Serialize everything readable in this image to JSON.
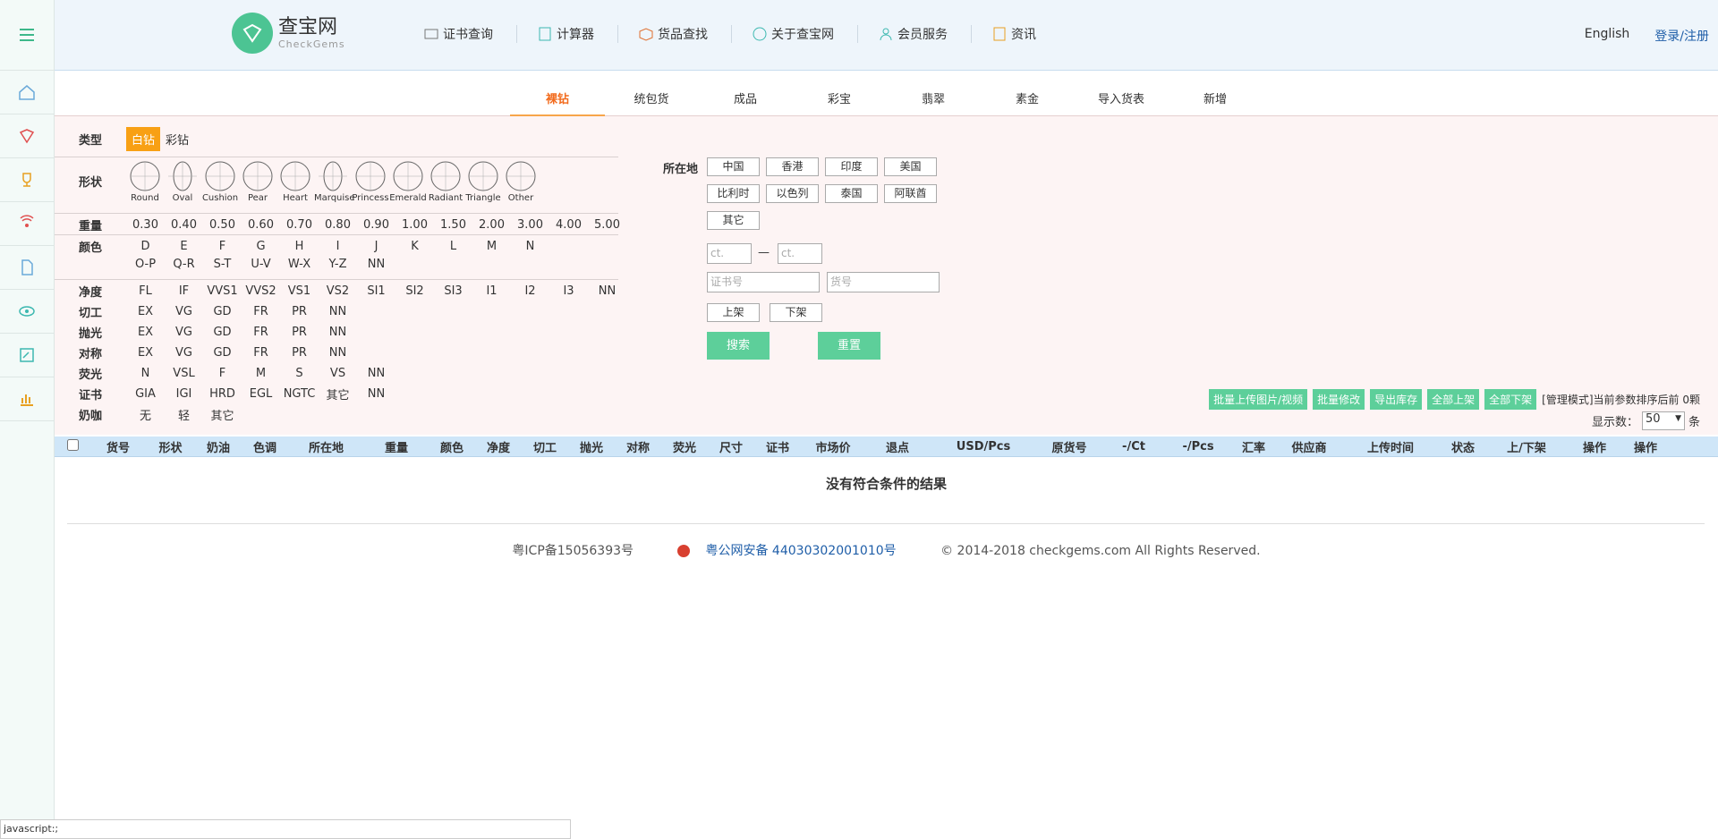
{
  "header": {
    "logo_cn": "查宝网",
    "logo_en": "CheckGems",
    "nav": [
      "证书查询",
      "计算器",
      "货品查找",
      "关于查宝网",
      "会员服务",
      "资讯"
    ],
    "lang": "English",
    "login": "登录/注册"
  },
  "tabs": [
    "裸钻",
    "统包货",
    "成品",
    "彩宝",
    "翡翠",
    "素金",
    "导入货表",
    "新增"
  ],
  "filters": {
    "type_label": "类型",
    "types": [
      "白钻",
      "彩钻"
    ],
    "shape_label": "形状",
    "shapes": [
      "Round",
      "Oval",
      "Cushion",
      "Pear",
      "Heart",
      "Marquise",
      "Princess",
      "Emerald",
      "Radiant",
      "Triangle",
      "Other"
    ],
    "weight_label": "重量",
    "weights": [
      "0.30",
      "0.40",
      "0.50",
      "0.60",
      "0.70",
      "0.80",
      "0.90",
      "1.00",
      "1.50",
      "2.00",
      "3.00",
      "4.00",
      "5.00"
    ],
    "color_label": "颜色",
    "colors1": [
      "D",
      "E",
      "F",
      "G",
      "H",
      "I",
      "J",
      "K",
      "L",
      "M",
      "N"
    ],
    "colors2": [
      "O-P",
      "Q-R",
      "S-T",
      "U-V",
      "W-X",
      "Y-Z",
      "NN"
    ],
    "clarity_label": "净度",
    "clarity": [
      "FL",
      "IF",
      "VVS1",
      "VVS2",
      "VS1",
      "VS2",
      "SI1",
      "SI2",
      "SI3",
      "I1",
      "I2",
      "I3",
      "NN"
    ],
    "cut_label": "切工",
    "cut": [
      "EX",
      "VG",
      "GD",
      "FR",
      "PR",
      "NN"
    ],
    "polish_label": "抛光",
    "polish": [
      "EX",
      "VG",
      "GD",
      "FR",
      "PR",
      "NN"
    ],
    "sym_label": "对称",
    "sym": [
      "EX",
      "VG",
      "GD",
      "FR",
      "PR",
      "NN"
    ],
    "fluor_label": "荧光",
    "fluor": [
      "N",
      "VSL",
      "F",
      "M",
      "S",
      "VS",
      "NN"
    ],
    "cert_label": "证书",
    "cert": [
      "GIA",
      "IGI",
      "HRD",
      "EGL",
      "NGTC",
      "其它",
      "NN"
    ],
    "milky_label": "奶咖",
    "milky": [
      "无",
      "轻",
      "其它"
    ]
  },
  "location": {
    "label": "所在地",
    "options": [
      "中国",
      "香港",
      "印度",
      "美国",
      "比利时",
      "以色列",
      "泰国",
      "阿联酋",
      "其它"
    ]
  },
  "inputs": {
    "ct_from": "ct.",
    "dash": "—",
    "ct_to": "ct.",
    "cert_no": "证书号",
    "stock_no": "货号"
  },
  "buttons": {
    "on_shelf": "上架",
    "off_shelf": "下架",
    "search": "搜索",
    "reset": "重置"
  },
  "actions": [
    "批量上传图片/视频",
    "批量修改",
    "导出库存",
    "全部上架",
    "全部下架"
  ],
  "mode_text": "[管理模式]当前参数排序后前 0颗",
  "perpage": {
    "label": "显示数：",
    "value": "50",
    "unit": "条"
  },
  "table": {
    "columns": [
      "货号",
      "形状",
      "奶油",
      "色调",
      "所在地",
      "重量",
      "颜色",
      "净度",
      "切工",
      "抛光",
      "对称",
      "荧光",
      "尺寸",
      "证书",
      "市场价",
      "退点",
      "USD/Pcs",
      "原货号",
      "-/Ct",
      "-/Pcs",
      "汇率",
      "供应商",
      "上传时间",
      "状态",
      "上/下架",
      "操作",
      "操作"
    ],
    "empty": "没有符合条件的结果"
  },
  "footer": {
    "icp": "粤ICP备15056393号",
    "police": "粤公网安备 44030302001010号",
    "copy": "© 2014-2018 checkgems.com All Rights Reserved."
  },
  "status": "javascript:;"
}
